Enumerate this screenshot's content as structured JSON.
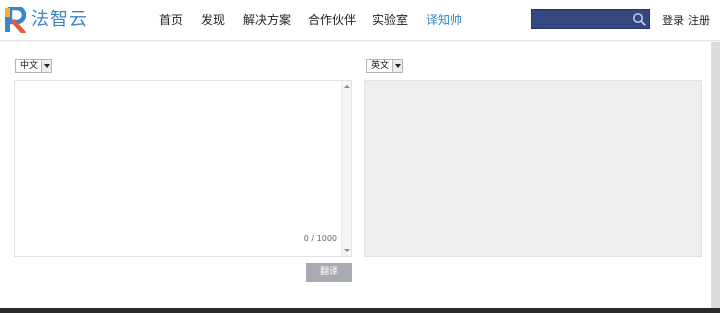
{
  "header": {
    "logo_text": "法智云",
    "nav": [
      {
        "label": "首页",
        "active": false
      },
      {
        "label": "发现",
        "active": false
      },
      {
        "label": "解决方案",
        "active": false
      },
      {
        "label": "合作伙伴",
        "active": false
      },
      {
        "label": "实验室",
        "active": false
      },
      {
        "label": "译知帅",
        "active": true
      }
    ],
    "search": {
      "value": "",
      "placeholder": ""
    },
    "login_label": "登录",
    "register_label": "注册"
  },
  "translator": {
    "source_lang": "中文",
    "target_lang": "英文",
    "source_text": "",
    "char_count": "0 / 1000",
    "translate_label": "翻译",
    "target_text": ""
  },
  "colors": {
    "accent": "#3a86c8",
    "search_bg": "#34477f",
    "button_bg": "#a8acb2",
    "result_bg": "#eeeeee"
  },
  "icons": [
    "logo-mark-icon",
    "search-icon",
    "dropdown-arrow-icon"
  ]
}
